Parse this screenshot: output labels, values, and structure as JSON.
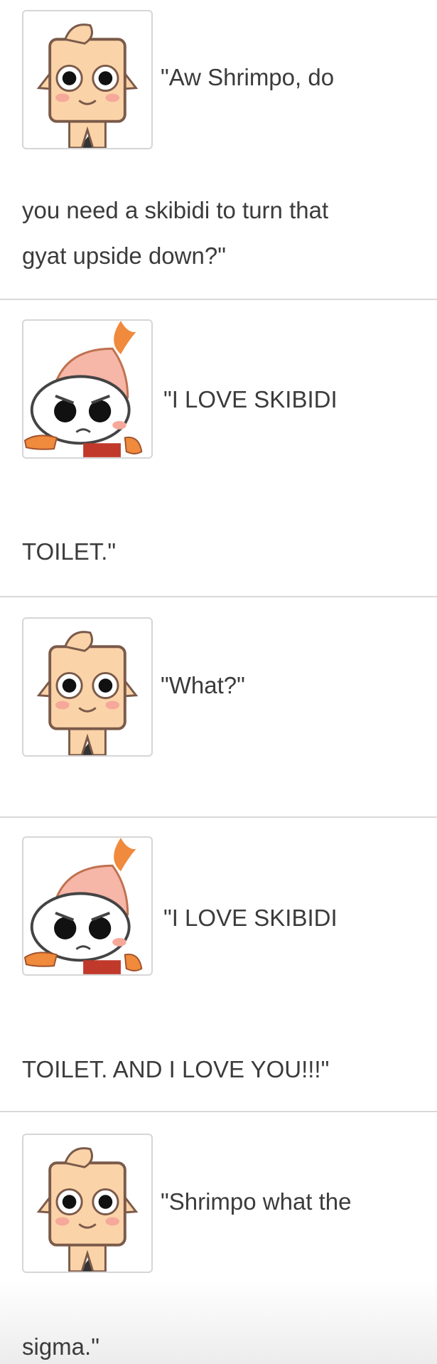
{
  "colors": {
    "text": "#3b3b3b",
    "divider": "#d9d9d9",
    "avatar_border": "#d6d6d6",
    "skin": "#fbd3a8",
    "shrimp_orange": "#f08a3c",
    "shrimp_pink": "#f6b6a8"
  },
  "entries": [
    {
      "speaker_icon": "cube-character-icon",
      "line1": "\"Aw Shrimpo, do",
      "line2": "you need a skibidi to turn that",
      "line3": "gyat upside down?\""
    },
    {
      "speaker_icon": "shrimp-character-icon",
      "line1": "\"I LOVE SKIBIDI",
      "line2": "TOILET.\""
    },
    {
      "speaker_icon": "cube-character-icon",
      "line1": "\"What?\""
    },
    {
      "speaker_icon": "shrimp-character-icon",
      "line1": "\"I LOVE SKIBIDI",
      "line2": "TOILET. AND I LOVE YOU!!!\""
    },
    {
      "speaker_icon": "cube-character-icon",
      "line1": "\"Shrimpo what the",
      "line2": "sigma.\""
    }
  ]
}
